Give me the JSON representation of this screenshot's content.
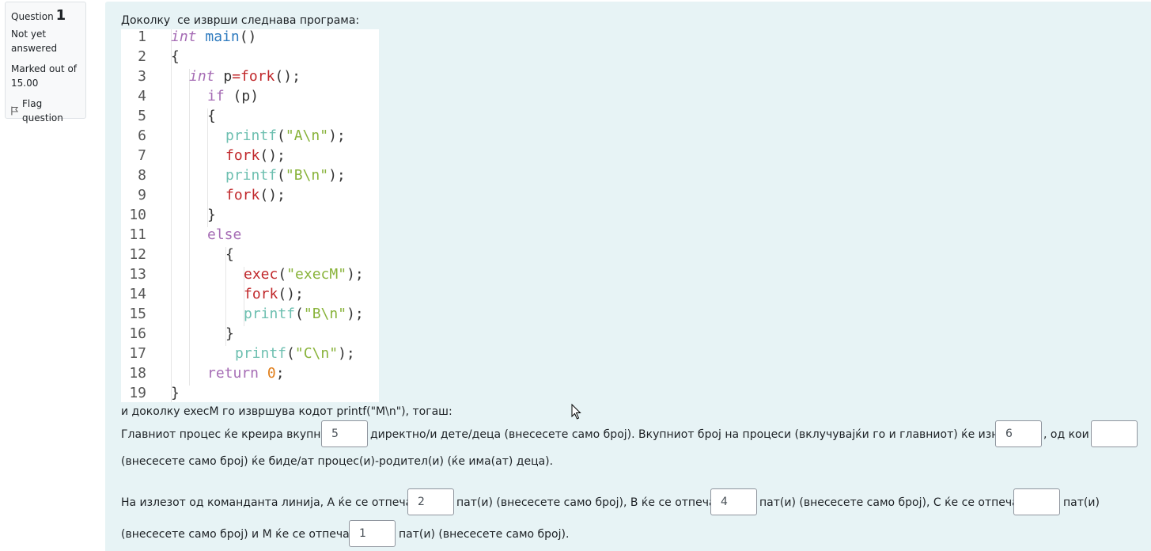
{
  "question_info": {
    "question_word": "Question",
    "number": "1",
    "state": "Not yet answered",
    "grade": "Marked out of 15.00",
    "flag_label": "Flag question"
  },
  "question": {
    "intro": "Доколку  се изврши следнава програма:",
    "code_lines": [
      {
        "n": "1"
      },
      {
        "n": "2"
      },
      {
        "n": "3"
      },
      {
        "n": "4"
      },
      {
        "n": "5"
      },
      {
        "n": "6"
      },
      {
        "n": "7"
      },
      {
        "n": "8"
      },
      {
        "n": "9"
      },
      {
        "n": "10"
      },
      {
        "n": "11"
      },
      {
        "n": "12"
      },
      {
        "n": "13"
      },
      {
        "n": "14"
      },
      {
        "n": "15"
      },
      {
        "n": "16"
      },
      {
        "n": "17"
      },
      {
        "n": "18"
      },
      {
        "n": "19"
      }
    ],
    "code_tokens": {
      "int": "int",
      "main": "main",
      "paren_pair": "()",
      "lbrace": "{",
      "rbrace": "}",
      "p": "p",
      "eq": "=",
      "fork": "fork",
      "call_end": "();",
      "if": "if",
      "cond": "(p)",
      "printf": "printf",
      "exec": "exec",
      "lp": "(",
      "rp_semi": ");",
      "sA": "\"A\\n\"",
      "sB": "\"B\\n\"",
      "sC": "\"C\\n\"",
      "sM": "\"execM\"",
      "else": "else",
      "return": "return",
      "zero": "0",
      "semi": ";"
    },
    "after_code": "и доколку execM го извршува кодот printf(\"M\\n\"), тогаш:",
    "p1_a": "Главниот процес ќе креира вкупно",
    "p1_b": "директно/и дете/деца (внесесете само број). Вкупниот број на процеси (вклучувајќи го и главниот) ќе изнесува",
    "p1_c": ", од кои",
    "p1_d": "(внесесете само број) ќе биде/ат  процес(и)-родител(и) (ќе има(ат) деца).",
    "p2_a": "На излезот од командантa линија, А ќе се отпечати",
    "p2_b": "пат(и) (внесесете само број), B ќе се отпечати",
    "p2_c": "пат(и) (внесесете само број), C ќе се отпечати",
    "p2_d": "пат(и)",
    "p2_e": "(внесесете само број) и М ќе се отпечати",
    "p2_f": "пат(и) (внесесете само број).",
    "answers": {
      "direct_children": "5",
      "total_processes": "6",
      "parents": "",
      "a_count": "2",
      "b_count": "4",
      "c_count": "",
      "m_count": "1"
    }
  }
}
